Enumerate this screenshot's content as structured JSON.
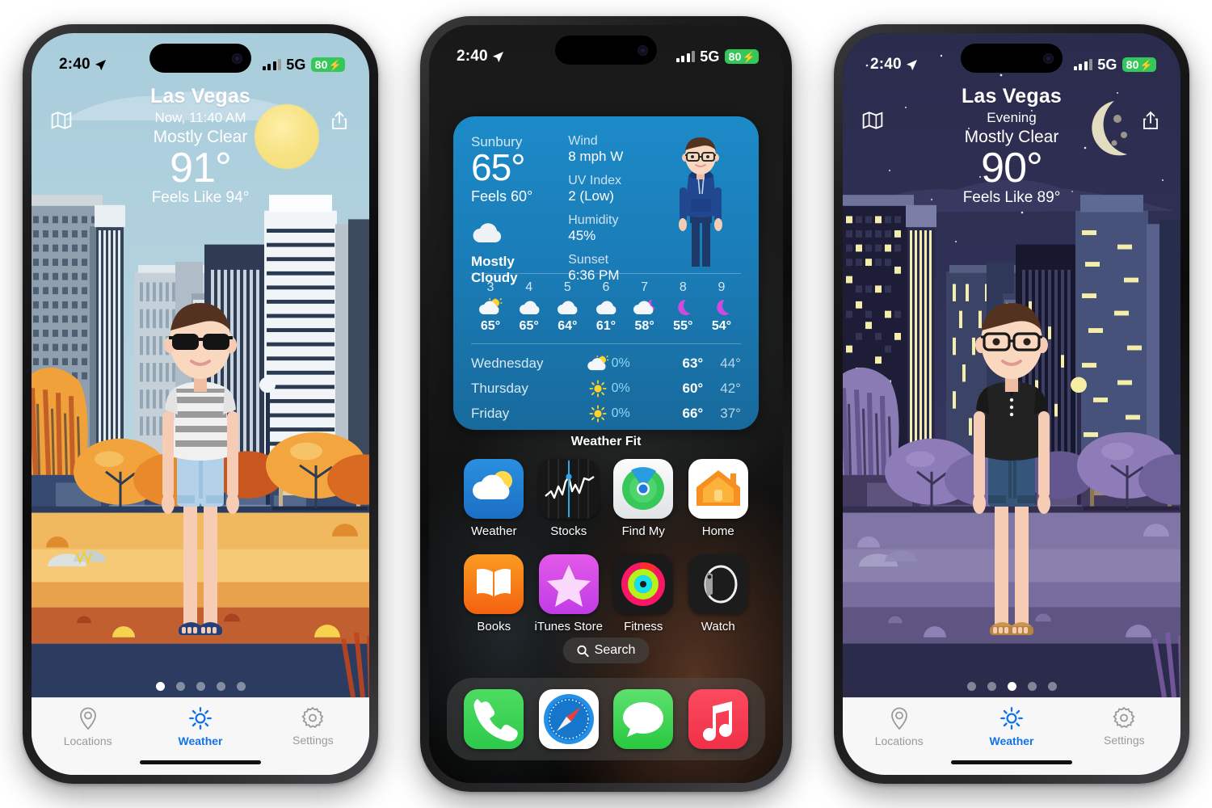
{
  "status_bar": {
    "time": "2:40",
    "network": "5G",
    "battery": "80",
    "battery_bolt": "⚡",
    "location_icon": "location-arrow-icon",
    "signal_icon": "cellular-bars-icon"
  },
  "phone_left": {
    "app": "Weather Fit",
    "header": {
      "map_icon": "map-icon",
      "share_icon": "share-icon",
      "city": "Las Vegas",
      "time_label": "Now, 11:40 AM",
      "condition": "Mostly Clear",
      "temperature": "91°",
      "feels_like": "Feels Like 94°",
      "sky_icon": "sun-icon"
    },
    "page_dots": {
      "count": 5,
      "active": 1
    },
    "avatar": {
      "accessory": "sunglasses",
      "top": "striped-tshirt",
      "bottom": "light-denim-shorts",
      "shoes": "blue-sandals"
    },
    "tabs": [
      {
        "label": "Locations",
        "icon": "location-pin-icon",
        "active": false
      },
      {
        "label": "Weather",
        "icon": "sun-icon",
        "active": true
      },
      {
        "label": "Settings",
        "icon": "gear-icon",
        "active": false
      }
    ]
  },
  "phone_mid": {
    "widget": {
      "place": "Sunbury",
      "temperature": "65°",
      "feels_like": "Feels 60°",
      "condition_icon": "cloud-icon",
      "condition": "Mostly\nCloudy",
      "metrics": [
        {
          "label": "Wind",
          "value": "8 mph W"
        },
        {
          "label": "UV Index",
          "value": "2 (Low)"
        },
        {
          "label": "Humidity",
          "value": "45%"
        },
        {
          "label": "Sunset",
          "value": "6:36 PM"
        }
      ],
      "avatar": {
        "accessory": "glasses",
        "top": "navy-hoodie",
        "bottom": "navy-pants"
      },
      "hourly": [
        {
          "hour": "3",
          "icon": "sun-cloud-icon",
          "temp": "65°"
        },
        {
          "hour": "4",
          "icon": "cloud-icon",
          "temp": "65°"
        },
        {
          "hour": "5",
          "icon": "cloud-icon",
          "temp": "64°"
        },
        {
          "hour": "6",
          "icon": "cloud-icon",
          "temp": "61°"
        },
        {
          "hour": "7",
          "icon": "moon-cloud-icon",
          "temp": "58°"
        },
        {
          "hour": "8",
          "icon": "moon-icon",
          "temp": "55°"
        },
        {
          "hour": "9",
          "icon": "moon-icon",
          "temp": "54°"
        }
      ],
      "daily": [
        {
          "day": "Wednesday",
          "icon": "sun-cloud-icon",
          "precip": "0%",
          "high": "63°",
          "low": "44°"
        },
        {
          "day": "Thursday",
          "icon": "sun-icon",
          "precip": "0%",
          "high": "60°",
          "low": "42°"
        },
        {
          "day": "Friday",
          "icon": "sun-icon",
          "precip": "0%",
          "high": "66°",
          "low": "37°"
        }
      ]
    },
    "widget_label": "Weather Fit",
    "apps": [
      {
        "name": "Weather",
        "icon": "weather-app-icon"
      },
      {
        "name": "Stocks",
        "icon": "stocks-app-icon"
      },
      {
        "name": "Find My",
        "icon": "findmy-app-icon"
      },
      {
        "name": "Home",
        "icon": "home-app-icon"
      },
      {
        "name": "Books",
        "icon": "books-app-icon"
      },
      {
        "name": "iTunes Store",
        "icon": "itunes-app-icon"
      },
      {
        "name": "Fitness",
        "icon": "fitness-app-icon"
      },
      {
        "name": "Watch",
        "icon": "watch-app-icon"
      }
    ],
    "search": {
      "label": "Search",
      "icon": "search-icon"
    },
    "dock": [
      {
        "name": "Phone",
        "icon": "phone-app-icon"
      },
      {
        "name": "Safari",
        "icon": "safari-app-icon"
      },
      {
        "name": "Messages",
        "icon": "messages-app-icon"
      },
      {
        "name": "Music",
        "icon": "music-app-icon"
      }
    ]
  },
  "phone_right": {
    "app": "Weather Fit",
    "header": {
      "map_icon": "map-icon",
      "share_icon": "share-icon",
      "city": "Las Vegas",
      "time_label": "Evening",
      "condition": "Mostly Clear",
      "temperature": "90°",
      "feels_like": "Feels Like 89°",
      "sky_icon": "crescent-moon-icon"
    },
    "page_dots": {
      "count": 5,
      "active": 3
    },
    "avatar": {
      "accessory": "glasses",
      "top": "black-polo-shirt",
      "bottom": "dark-denim-shorts",
      "shoes": "tan-sandals"
    },
    "tabs": [
      {
        "label": "Locations",
        "icon": "location-pin-icon",
        "active": false
      },
      {
        "label": "Weather",
        "icon": "sun-icon",
        "active": true
      },
      {
        "label": "Settings",
        "icon": "gear-icon",
        "active": false
      }
    ]
  },
  "colors": {
    "accent_blue": "#1273e6",
    "widget_blue": "#1c8ac8",
    "battery_green": "#34c759",
    "day_sky": "#b6d3de",
    "night_sky": "#34345c"
  }
}
